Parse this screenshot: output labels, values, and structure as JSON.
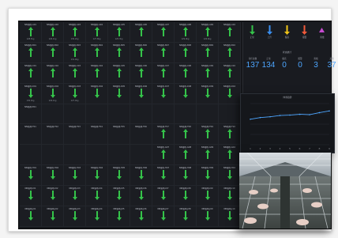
{
  "grid": {
    "cells": [
      {
        "label": "NN猪场-A01",
        "value": "128.5kg",
        "arrow": "up"
      },
      {
        "label": "NN猪场-A02",
        "value": "126.1kg",
        "arrow": "up"
      },
      {
        "label": "NN猪场-A03",
        "value": "130.2kg",
        "arrow": "up"
      },
      {
        "label": "NN猪场-A04",
        "value": "127.8kg",
        "arrow": "up"
      },
      {
        "label": "NN猪场-A05",
        "value": "125.3kg",
        "arrow": "up"
      },
      {
        "label": "NN猪场-A06",
        "value": "",
        "arrow": "up"
      },
      {
        "label": "NN猪场-A07",
        "value": "",
        "arrow": "up"
      },
      {
        "label": "NN猪场-A08",
        "value": "129.9kg",
        "arrow": "up"
      },
      {
        "label": "NN猪场-A09",
        "value": "126.6kg",
        "arrow": "up"
      },
      {
        "label": "NN猪场-A10",
        "value": "",
        "arrow": "up"
      },
      {
        "label": "NN猪场-B01",
        "value": "",
        "arrow": "up"
      },
      {
        "label": "NN猪场-B02",
        "value": "",
        "arrow": "up"
      },
      {
        "label": "NN猪场-B03",
        "value": "131.0kg",
        "arrow": "up"
      },
      {
        "label": "NN猪场-B04",
        "value": "",
        "arrow": "up"
      },
      {
        "label": "NN猪场-B05",
        "value": "",
        "arrow": "up"
      },
      {
        "label": "NN猪场-B06",
        "value": "",
        "arrow": "up"
      },
      {
        "label": "NN猪场-B07",
        "value": "",
        "arrow": "up"
      },
      {
        "label": "NN猪场-B08",
        "value": "",
        "arrow": "up"
      },
      {
        "label": "NN猪场-B09",
        "value": "",
        "arrow": "up"
      },
      {
        "label": "NN猪场-B10",
        "value": "",
        "arrow": "up"
      },
      {
        "label": "NN猪场-C01",
        "value": "",
        "arrow": "up"
      },
      {
        "label": "NN猪场-C02",
        "value": "",
        "arrow": "up"
      },
      {
        "label": "NN猪场-C03",
        "value": "",
        "arrow": "up"
      },
      {
        "label": "NN猪场-C04",
        "value": "",
        "arrow": "up"
      },
      {
        "label": "NN猪场-C05",
        "value": "",
        "arrow": "up"
      },
      {
        "label": "NN猪场-C06",
        "value": "",
        "arrow": "up"
      },
      {
        "label": "NN猪场-C07",
        "value": "",
        "arrow": "up"
      },
      {
        "label": "NN猪场-C08",
        "value": "",
        "arrow": "up"
      },
      {
        "label": "NN猪场-C09",
        "value": "",
        "arrow": "up"
      },
      {
        "label": "NN猪场-C10",
        "value": "",
        "arrow": "up"
      },
      {
        "label": "NN猪场-D01",
        "value": "130.4kg",
        "arrow": "down"
      },
      {
        "label": "NN猪场-D02",
        "value": "129.1kg",
        "arrow": "down"
      },
      {
        "label": "NN猪场-D03",
        "value": "127.4kg",
        "arrow": "down"
      },
      {
        "label": "NN猪场-D04",
        "value": "",
        "arrow": "down"
      },
      {
        "label": "NN猪场-D05",
        "value": "",
        "arrow": "down"
      },
      {
        "label": "NN猪场-D06",
        "value": "",
        "arrow": "down"
      },
      {
        "label": "NN猪场-D07",
        "value": "",
        "arrow": "down"
      },
      {
        "label": "NN猪场-D08",
        "value": "",
        "arrow": "down"
      },
      {
        "label": "NN猪场-D09",
        "value": "",
        "arrow": "down"
      },
      {
        "label": "NN猪场-D10",
        "value": "",
        "arrow": "down"
      },
      {
        "label": "NN猪场-E01",
        "value": "",
        "arrow": "none"
      },
      {
        "label": "",
        "value": "",
        "arrow": "none"
      },
      {
        "label": "",
        "value": "",
        "arrow": "none"
      },
      {
        "label": "",
        "value": "",
        "arrow": "none"
      },
      {
        "label": "",
        "value": "",
        "arrow": "none"
      },
      {
        "label": "",
        "value": "",
        "arrow": "none"
      },
      {
        "label": "",
        "value": "",
        "arrow": "none"
      },
      {
        "label": "",
        "value": "",
        "arrow": "none"
      },
      {
        "label": "",
        "value": "",
        "arrow": "none"
      },
      {
        "label": "",
        "value": "",
        "arrow": "none"
      },
      {
        "label": "NN猪场-F01",
        "value": "",
        "arrow": "none"
      },
      {
        "label": "NN猪场-F02",
        "value": "",
        "arrow": "none"
      },
      {
        "label": "NN猪场-F03",
        "value": "",
        "arrow": "none"
      },
      {
        "label": "NN猪场-F04",
        "value": "",
        "arrow": "none"
      },
      {
        "label": "NN猪场-F05",
        "value": "",
        "arrow": "none"
      },
      {
        "label": "NN猪场-F06",
        "value": "",
        "arrow": "none"
      },
      {
        "label": "NN猪场-F07",
        "value": "",
        "arrow": "up"
      },
      {
        "label": "NN猪场-F08",
        "value": "",
        "arrow": "up"
      },
      {
        "label": "NN猪场-F09",
        "value": "",
        "arrow": "up"
      },
      {
        "label": "NN猪场-F10",
        "value": "",
        "arrow": "up"
      },
      {
        "label": "",
        "value": "",
        "arrow": "none"
      },
      {
        "label": "",
        "value": "",
        "arrow": "none"
      },
      {
        "label": "",
        "value": "",
        "arrow": "none"
      },
      {
        "label": "",
        "value": "",
        "arrow": "none"
      },
      {
        "label": "",
        "value": "",
        "arrow": "none"
      },
      {
        "label": "",
        "value": "",
        "arrow": "none"
      },
      {
        "label": "NN猪场-G07",
        "value": "",
        "arrow": "up"
      },
      {
        "label": "NN猪场-G08",
        "value": "",
        "arrow": "up"
      },
      {
        "label": "NN猪场-G09",
        "value": "",
        "arrow": "up"
      },
      {
        "label": "NN猪场-G10",
        "value": "",
        "arrow": "up"
      },
      {
        "label": "NN猪场-H01",
        "value": "",
        "arrow": "down"
      },
      {
        "label": "NN猪场-H02",
        "value": "",
        "arrow": "down"
      },
      {
        "label": "NN猪场-H03",
        "value": "",
        "arrow": "down"
      },
      {
        "label": "NN猪场-H04",
        "value": "",
        "arrow": "down"
      },
      {
        "label": "NN猪场-H05",
        "value": "",
        "arrow": "down"
      },
      {
        "label": "NN猪场-H06",
        "value": "",
        "arrow": "down"
      },
      {
        "label": "NN猪场-H07",
        "value": "",
        "arrow": "down"
      },
      {
        "label": "NN猪场-H08",
        "value": "",
        "arrow": "down"
      },
      {
        "label": "NN猪场-H09",
        "value": "",
        "arrow": "down"
      },
      {
        "label": "NN猪场-H10",
        "value": "",
        "arrow": "down"
      },
      {
        "label": "NN猪场-I01",
        "value": "",
        "arrow": "down"
      },
      {
        "label": "NN猪场-I02",
        "value": "",
        "arrow": "down"
      },
      {
        "label": "NN猪场-I03",
        "value": "",
        "arrow": "down"
      },
      {
        "label": "NN猪场-I04",
        "value": "",
        "arrow": "down"
      },
      {
        "label": "NN猪场-I05",
        "value": "",
        "arrow": "down"
      },
      {
        "label": "NN猪场-I06",
        "value": "",
        "arrow": "down"
      },
      {
        "label": "NN猪场-I07",
        "value": "",
        "arrow": "down"
      },
      {
        "label": "NN猪场-I08",
        "value": "",
        "arrow": "down"
      },
      {
        "label": "NN猪场-I09",
        "value": "",
        "arrow": "down"
      },
      {
        "label": "NN猪场-I10",
        "value": "",
        "arrow": "down"
      },
      {
        "label": "NN猪场-J01",
        "value": "",
        "arrow": "down"
      },
      {
        "label": "NN猪场-J02",
        "value": "",
        "arrow": "down"
      },
      {
        "label": "NN猪场-J03",
        "value": "",
        "arrow": "down"
      },
      {
        "label": "NN猪场-J04",
        "value": "",
        "arrow": "down"
      },
      {
        "label": "NN猪场-J05",
        "value": "",
        "arrow": "down"
      },
      {
        "label": "NN猪场-J06",
        "value": "",
        "arrow": "down"
      },
      {
        "label": "NN猪场-J07",
        "value": "",
        "arrow": "down"
      },
      {
        "label": "NN猪场-J08",
        "value": "",
        "arrow": "down"
      },
      {
        "label": "NN猪场-J09",
        "value": "",
        "arrow": "down"
      },
      {
        "label": "NN猪场-J10",
        "value": "",
        "arrow": "down"
      }
    ]
  },
  "legend": [
    {
      "label": "正常",
      "color": "#35c34a",
      "icon": "arrow-down-icon"
    },
    {
      "label": "上升",
      "color": "#3a8ff0",
      "icon": "arrow-down-icon"
    },
    {
      "label": "偏高",
      "color": "#f0c419",
      "icon": "arrow-down-icon"
    },
    {
      "label": "报警",
      "color": "#f15a3a",
      "icon": "arrow-down-icon"
    },
    {
      "label": "离线",
      "color": "#c64bd1",
      "icon": "triangle-icon"
    }
  ],
  "stats": {
    "title": "状态统计",
    "items": [
      {
        "label": "存栏总数",
        "value": "137"
      },
      {
        "label": "正常",
        "value": "134"
      },
      {
        "label": "偏高",
        "value": "0"
      },
      {
        "label": "报警",
        "value": "0"
      },
      {
        "label": "离线",
        "value": "3"
      },
      {
        "label": "其他",
        "value": "37"
      }
    ]
  },
  "chart_panel": {
    "title": "体重趋势"
  },
  "chart_data": {
    "type": "line",
    "title": "体重趋势",
    "categories": [
      "1",
      "2",
      "3",
      "4",
      "5",
      "6",
      "7",
      "8",
      "9"
    ],
    "series": [
      {
        "values": [
          62,
          66,
          68,
          71,
          72,
          74,
          73,
          78,
          82
        ]
      }
    ],
    "ylim": [
      0,
      100
    ],
    "grid": true
  },
  "photo": {
    "icon": "barn-photo"
  },
  "colors": {
    "up": "#35c34a",
    "down": "#35c34a",
    "accent": "#4da6ff"
  }
}
